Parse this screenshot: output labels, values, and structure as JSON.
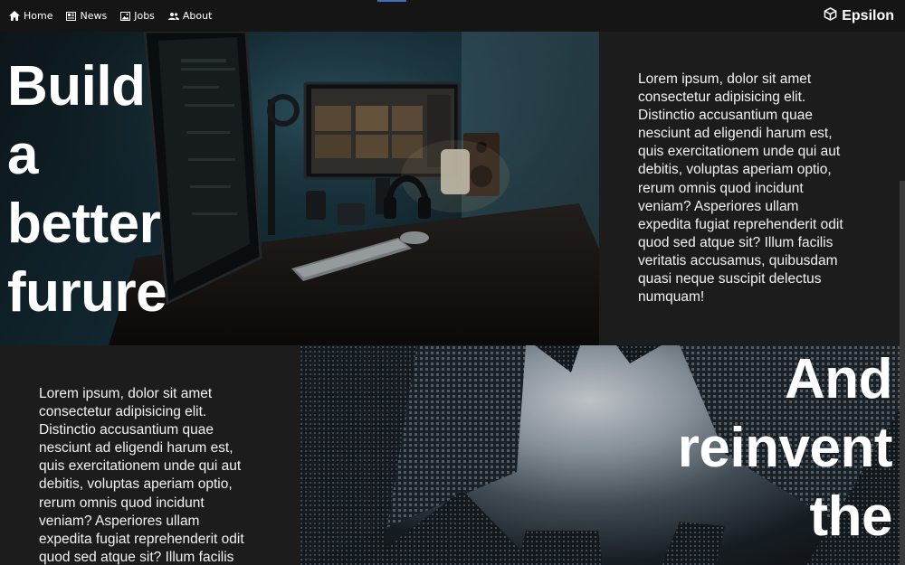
{
  "nav": {
    "items": [
      {
        "label": "Home",
        "icon": "home-icon"
      },
      {
        "label": "News",
        "icon": "newspaper-icon"
      },
      {
        "label": "Jobs",
        "icon": "image-icon"
      },
      {
        "label": "About",
        "icon": "users-icon"
      }
    ],
    "brand": "Epsilon",
    "brand_icon": "cube-icon"
  },
  "section1": {
    "headline": [
      "Build",
      "a",
      "better",
      "furure"
    ],
    "text": [
      "Lorem ipsum, dolor sit amet",
      "consectetur adipisicing elit.",
      "Distinctio accusantium quae",
      "nesciunt ad eligendi harum est,",
      "quis exercitationem unde qui aut",
      "debitis, voluptas aperiam optio,",
      "rerum omnis quod incidunt",
      "veniam? Asperiores ullam",
      "expedita fugiat reprehenderit odit",
      "quod sed atque sit? Illum facilis",
      "veritatis accusamus, quibusdam",
      "quasi neque suscipit delectus",
      "numquam!"
    ]
  },
  "section2": {
    "headline": [
      "And",
      "reinvent",
      "the"
    ],
    "text": [
      "Lorem ipsum, dolor sit amet",
      "consectetur adipisicing elit.",
      "Distinctio accusantium quae",
      "nesciunt ad eligendi harum est,",
      "quis exercitationem unde qui aut",
      "debitis, voluptas aperiam optio,",
      "rerum omnis quod incidunt",
      "veniam? Asperiores ullam",
      "expedita fugiat reprehenderit odit",
      "quod sed atque sit? Illum facilis"
    ]
  },
  "colors": {
    "nav_bg": "#151515",
    "panel_bg": "#1c1c1c",
    "accent": "#3f6fb8"
  }
}
